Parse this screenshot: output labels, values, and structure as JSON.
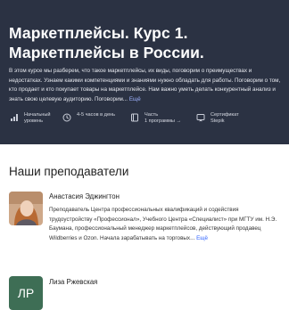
{
  "hero": {
    "title": "Маркетплейсы. Курс 1. Маркетплейсы в России.",
    "description": "В этом курсе мы разберем, что такое маркетплейсы, их виды, поговорим о преимуществах и недостатках. Узнаем какими компетенциями и знаниями нужно обладать для работы. Поговорим о том, кто продает и кто покупает товары на маркетплейсе. Нам важно уметь делать конкурентный анализ и знать свою целевую аудиторию. Поговорим...",
    "more_label": "Ещё",
    "meta": {
      "level": {
        "icon": "chart-bars-icon",
        "line1": "Начальный",
        "line2": "уровень"
      },
      "duration": {
        "icon": "clock-icon",
        "text": "4-5 часов в день"
      },
      "part": {
        "icon": "book-icon",
        "line1": "Часть",
        "line2": "1 программы →"
      },
      "certificate": {
        "icon": "certificate-icon",
        "line1": "Сертификат",
        "line2": "Stepik"
      }
    }
  },
  "teachers_title": "Наши преподаватели",
  "teachers": [
    {
      "name": "Анастасия Эджингтон",
      "bio": "Преподаватель Центра профессиональных квалификаций и содействия трудоустройству «Профессионал», Учебного Центра «Специалист» при МГТУ им. Н.Э. Баумана, профессиональный менеджер маркетплейсов, действующий продавец Wildberries и Ozon. Начала зарабатывать на торговых...",
      "more_label": "Ещё"
    },
    {
      "name": "Лиза Ржевская",
      "initials": "ЛР"
    }
  ]
}
